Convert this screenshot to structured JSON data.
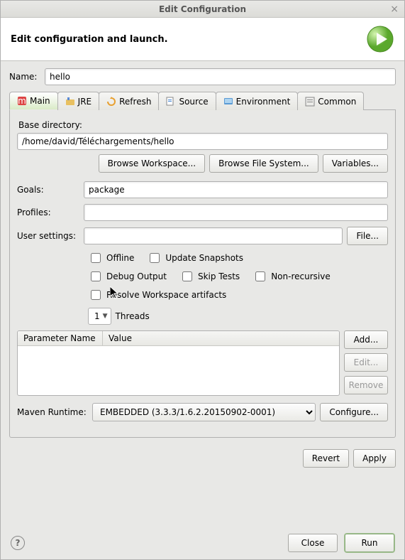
{
  "titlebar": {
    "title": "Edit Configuration"
  },
  "header": {
    "title": "Edit configuration and launch."
  },
  "name": {
    "label": "Name:",
    "value": "hello"
  },
  "tabs": {
    "main": "Main",
    "jre": "JRE",
    "refresh": "Refresh",
    "source": "Source",
    "environment": "Environment",
    "common": "Common"
  },
  "main": {
    "base_dir_label": "Base directory:",
    "base_dir_value": "/home/david/Téléchargements/hello",
    "browse_workspace": "Browse Workspace...",
    "browse_filesystem": "Browse File System...",
    "variables": "Variables...",
    "goals_label": "Goals:",
    "goals_value": "package",
    "profiles_label": "Profiles:",
    "profiles_value": "",
    "user_settings_label": "User settings:",
    "user_settings_value": "",
    "file_btn": "File...",
    "cb_offline": "Offline",
    "cb_update": "Update Snapshots",
    "cb_debug": "Debug Output",
    "cb_skip": "Skip Tests",
    "cb_nonrec": "Non-recursive",
    "cb_resolve": "Resolve Workspace artifacts",
    "threads_value": "1",
    "threads_label": "Threads",
    "col_param": "Parameter Name",
    "col_value": "Value",
    "add_btn": "Add...",
    "edit_btn": "Edit...",
    "remove_btn": "Remove",
    "runtime_label": "Maven Runtime:",
    "runtime_value": "EMBEDDED (3.3.3/1.6.2.20150902-0001)",
    "configure_btn": "Configure..."
  },
  "actions": {
    "revert": "Revert",
    "apply": "Apply"
  },
  "footer": {
    "close": "Close",
    "run": "Run"
  }
}
